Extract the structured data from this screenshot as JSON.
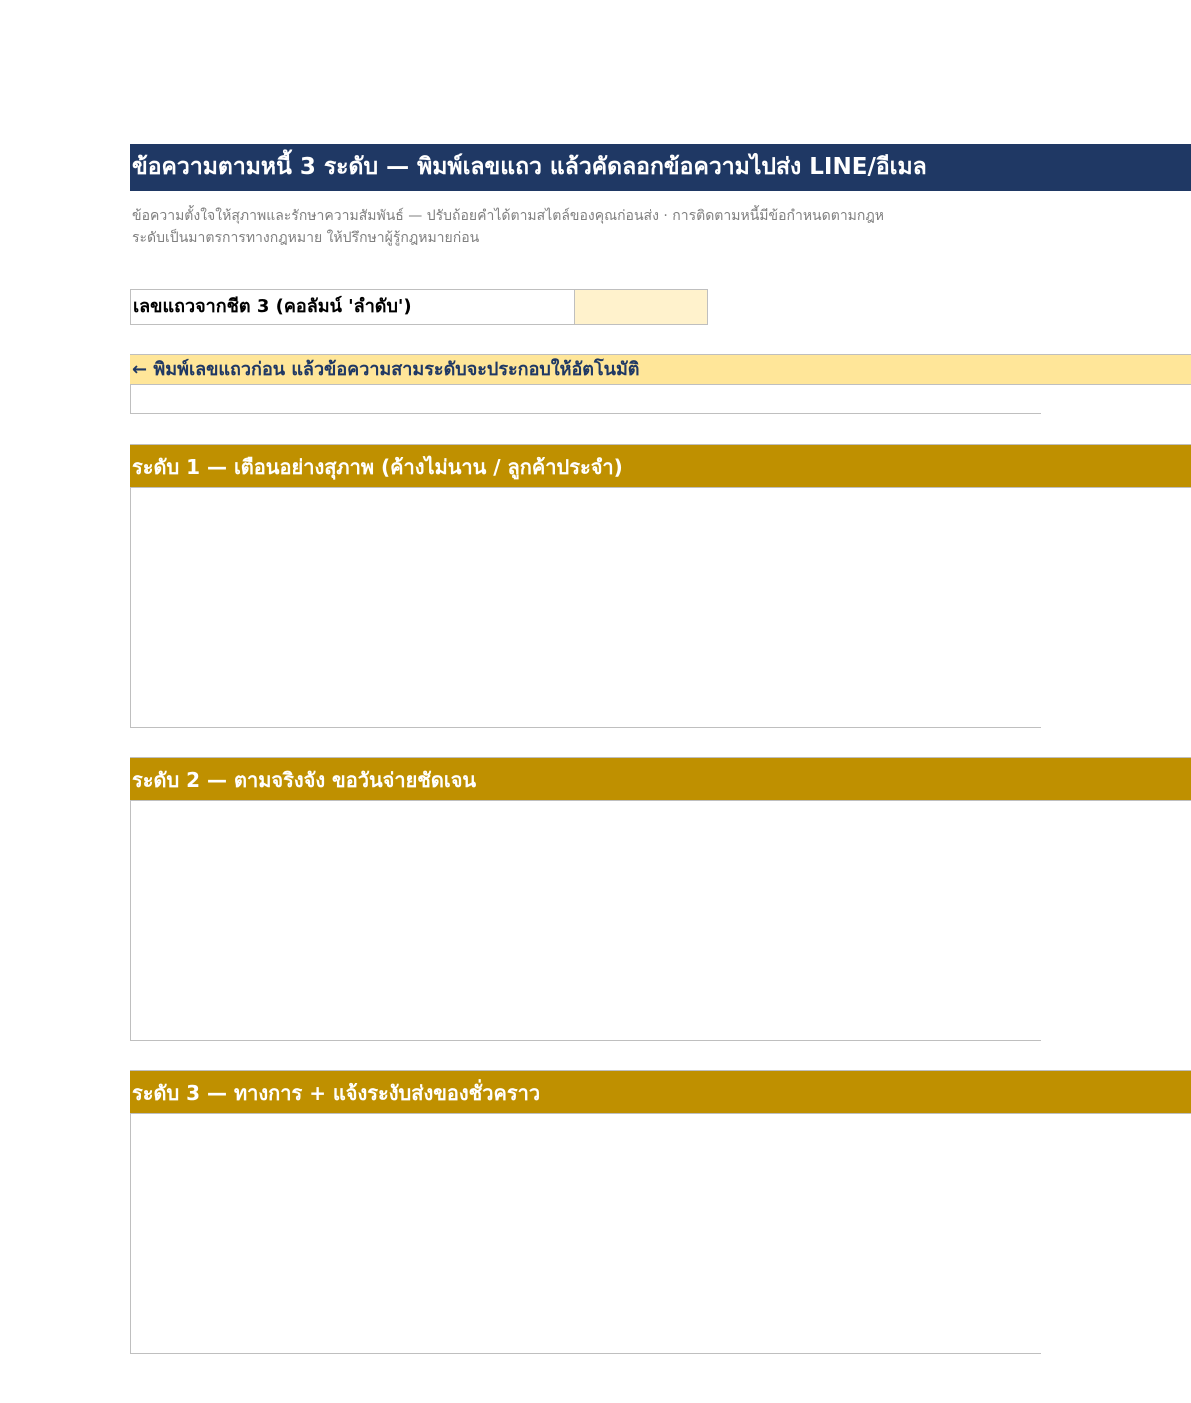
{
  "title": "ข้อความตามหนี้ 3 ระดับ — พิมพ์เลขแถว แล้วคัดลอกข้อความไปส่ง LINE/อีเมล",
  "subtitle": {
    "line1": "ข้อความตั้งใจให้สุภาพและรักษาความสัมพันธ์ — ปรับถ้อยคำได้ตามสไตล์ของคุณก่อนส่ง · การติดตามหนี้มีข้อกำหนดตามกฎห",
    "line2": "ระดับเป็นมาตรการทางกฎหมาย ให้ปรึกษาผู้รู้กฎหมายก่อน"
  },
  "row_input": {
    "label": "เลขแถวจากชีต 3 (คอลัมน์ 'ลำดับ')",
    "value": ""
  },
  "hint": "← พิมพ์เลขแถวก่อน แล้วข้อความสามระดับจะประกอบให้อัตโนมัติ",
  "levels": [
    {
      "heading": "ระดับ 1 — เตือนอย่างสุภาพ (ค้างไม่นาน / ลูกค้าประจำ)",
      "body": ""
    },
    {
      "heading": "ระดับ 2 — ตามจริงจัง ขอวันจ่ายชัดเจน",
      "body": ""
    },
    {
      "heading": "ระดับ 3 — ทางการ + แจ้งระงับส่งของชั่วคราว",
      "body": ""
    }
  ],
  "colors": {
    "title_bg": "#1f3864",
    "level_bg": "#bf9000",
    "hint_bg": "#ffe699",
    "input_bg": "#fff2cc"
  }
}
